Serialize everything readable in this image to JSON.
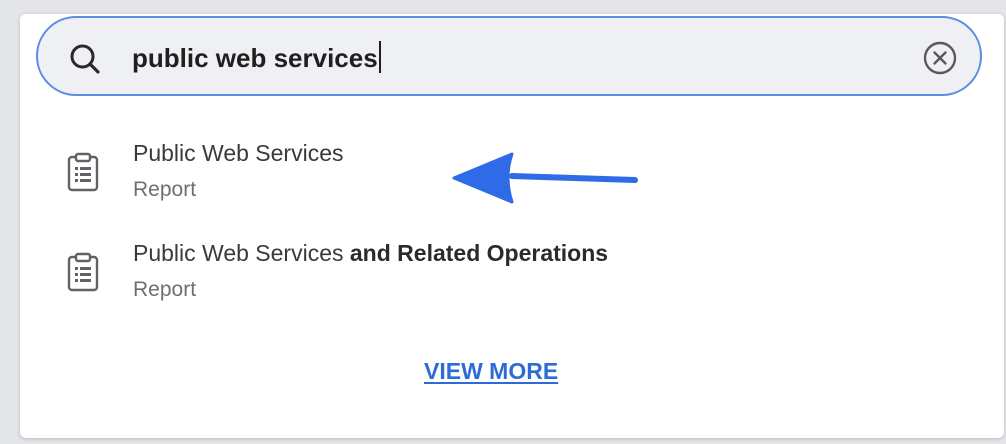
{
  "search": {
    "query": "public web services"
  },
  "results": [
    {
      "title_plain": "Public Web Services",
      "title_bold": "",
      "type": "Report",
      "icon": "clipboard-report-icon"
    },
    {
      "title_plain": "Public Web Services ",
      "title_bold": "and Related Operations",
      "type": "Report",
      "icon": "clipboard-report-icon"
    }
  ],
  "view_more_label": "VIEW MORE",
  "colors": {
    "accent": "#2f6bd8",
    "search_border": "#5b8de0",
    "search_bg": "#eef0f3",
    "annotation_arrow": "#2f6be6"
  }
}
